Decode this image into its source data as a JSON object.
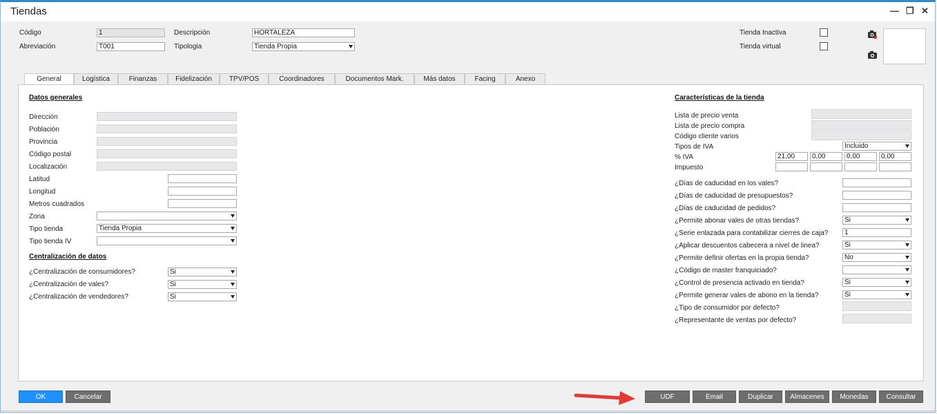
{
  "window": {
    "title": "Tiendas",
    "minimize": "—",
    "restore": "❐",
    "close": "✕"
  },
  "header": {
    "codigo": {
      "label": "Código",
      "value": "1"
    },
    "abreviacion": {
      "label": "Abreviación",
      "value": "T001"
    },
    "descripcion": {
      "label": "Descripción",
      "value": "HORTALEZA"
    },
    "tipologia": {
      "label": "Tipologia",
      "value": "Tienda Propia"
    },
    "inactiva": {
      "label": "Tienda Inactiva"
    },
    "virtual": {
      "label": "Tienda virtual"
    }
  },
  "tabs": [
    "General",
    "Logística",
    "Finanzas",
    "Fidelización",
    "TPV/POS",
    "Coordinadores",
    "Documentos Mark.",
    "Más datos",
    "Facing",
    "Anexo"
  ],
  "left": {
    "datos_title": "Datos generales",
    "direccion": "Dirección",
    "poblacion": "Población",
    "provincia": "Provincia",
    "codigo_postal": "Código postal",
    "localizacion": "Localización",
    "latitud": "Latitud",
    "longitud": "Longitud",
    "metros": "Metros cuadrados",
    "zona": "Zona",
    "tipo_tienda": {
      "label": "Tipo tienda",
      "value": "Tienda Propia"
    },
    "tipo_tienda_iv": "Tipo tienda IV",
    "central_title": "Centralización de datos",
    "consumidores": {
      "label": "¿Centralización de consumidores?",
      "value": "Si"
    },
    "vales": {
      "label": "¿Centralización de vales?",
      "value": "Si"
    },
    "vendedores": {
      "label": "¿Centralización de vendedores?",
      "value": "Si"
    }
  },
  "right": {
    "title": "Características de la tienda",
    "lista_venta": "Lista de precio venta",
    "lista_compra": "Lista de precio compra",
    "cliente_varios": "Código cliente varios",
    "tipos_iva": {
      "label": "Tipos de IVA",
      "value": "Incluido"
    },
    "pct_iva": {
      "label": "% IVA",
      "values": [
        "21,00",
        "0,00",
        "0,00",
        "0,00"
      ]
    },
    "impuesto": "Impuesto",
    "cad_vales": "¿Días de caducidad en los vales?",
    "cad_presupuestos": "¿Días de caducidad de presupuestos?",
    "cad_pedidos": "¿Días de caducidad de pedidos?",
    "abonar_vales": {
      "label": "¿Permite abonar vales de otras tiendas?",
      "value": "Si"
    },
    "serie_enlazada": {
      "label": "¿Serie enlazada para contabilizar cierres de caja?",
      "value": "1"
    },
    "descuentos": {
      "label": "¿Aplicar descuentos cabecera a nivel de linea?",
      "value": "Si"
    },
    "ofertas": {
      "label": "¿Permite definir ofertas en la propia tienda?",
      "value": "No"
    },
    "master": {
      "label": "¿Código de master franquiciado?",
      "value": ""
    },
    "presencia": {
      "label": "¿Control de presencia activado en tienda?",
      "value": "Si"
    },
    "vales_abono": {
      "label": "¿Permite generar vales de abono en la tienda?",
      "value": "Si"
    },
    "tipo_consumidor": "¿Tipo de consumidor por defecto?",
    "representante": "¿Representante de ventas por defecto?"
  },
  "buttons": {
    "ok": "OK",
    "cancel": "Cancelar",
    "udf": "UDF",
    "email": "Email",
    "duplicar": "Duplicar",
    "almacenes": "Almacenes",
    "monedas": "Monedas",
    "consultar": "Consultar"
  },
  "colors": {
    "accent": "#1e90ff",
    "button": "#6e6e6e",
    "arrow": "#e53935",
    "titlebar_border": "#2a8ad4"
  }
}
